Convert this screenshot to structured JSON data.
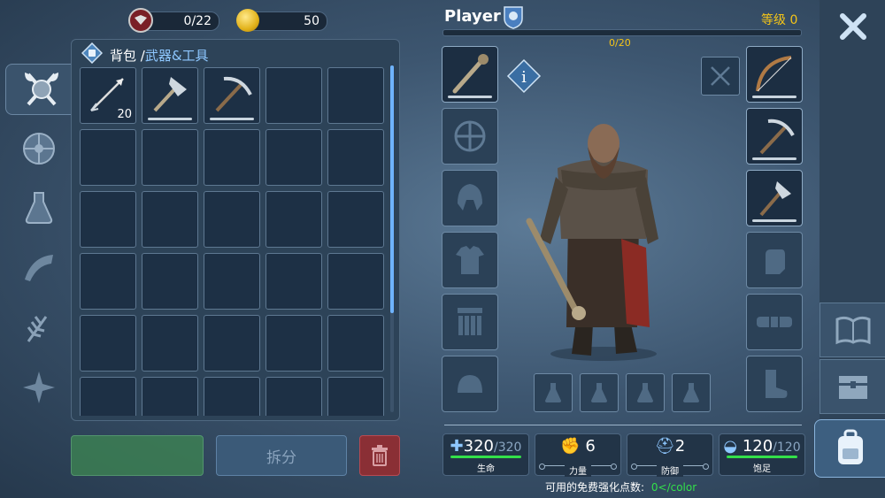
{
  "top": {
    "gems": "0/22",
    "coins": "50"
  },
  "inventory": {
    "breadcrumb_root": "背包",
    "breadcrumb_sep": "/",
    "breadcrumb_current": "武器&工具",
    "items": [
      {
        "icon": "spear-icon",
        "qty": "20"
      },
      {
        "icon": "axe-icon",
        "qty": ""
      },
      {
        "icon": "pickaxe-icon",
        "qty": ""
      }
    ],
    "split_label": "拆分"
  },
  "character": {
    "name": "Player",
    "level_label": "等级",
    "level": "0",
    "xp": "0/20",
    "stats": [
      {
        "icon": "health-icon",
        "value": "320",
        "max": "/320",
        "label": "生命"
      },
      {
        "icon": "strength-icon",
        "value": "6",
        "max": "",
        "label": "力量"
      },
      {
        "icon": "defense-icon",
        "value": "2",
        "max": "",
        "label": "防御"
      },
      {
        "icon": "food-icon",
        "value": "120",
        "max": "/120",
        "label": "饱足"
      }
    ],
    "free_points_text": "可用的免费强化点数:",
    "free_points_value": "0</color"
  },
  "colors": {
    "accent_blue": "#8ec7ff",
    "level_yellow": "#f5c518",
    "stat_green": "#33e04a"
  }
}
